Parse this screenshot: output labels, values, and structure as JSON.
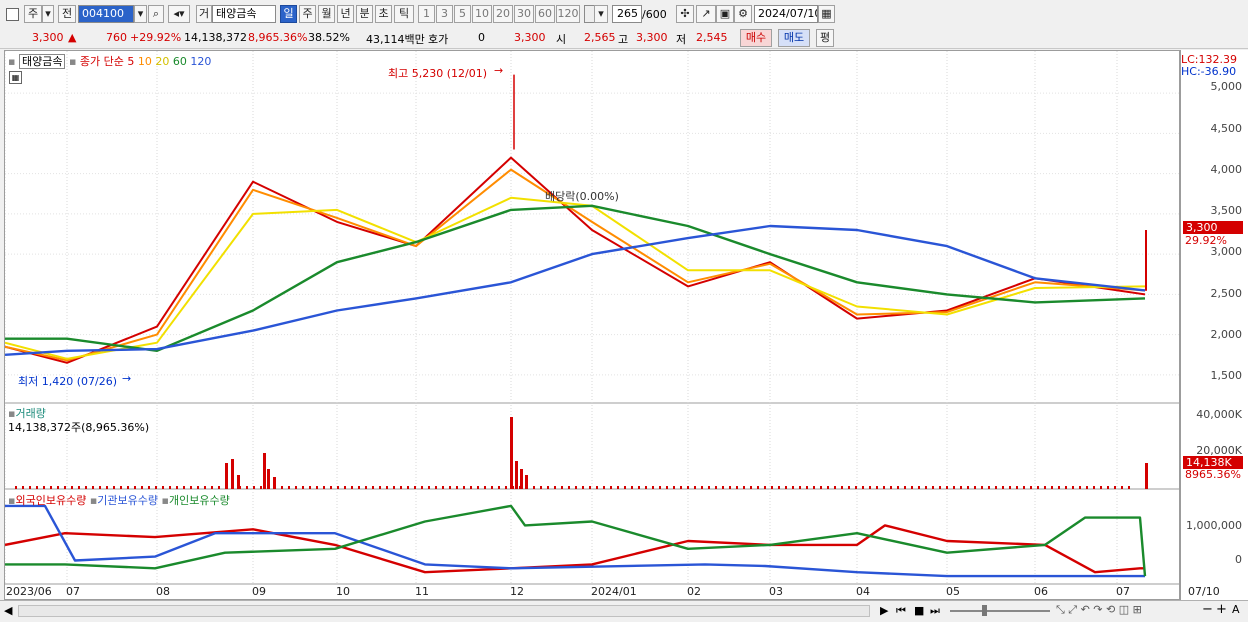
{
  "toolbar": {
    "tab_stock": "주",
    "tab_prev": "전",
    "code": "004100",
    "hoga_label": "거",
    "name": "태양금속",
    "periods": [
      "일",
      "주",
      "월",
      "년",
      "분",
      "초",
      "틱"
    ],
    "selected_period": "일",
    "minutes": [
      "1",
      "3",
      "5",
      "10",
      "20",
      "30",
      "60",
      "120"
    ],
    "count": "265",
    "total": "/600",
    "date": "2024/07/10"
  },
  "quote": {
    "price": "3,300",
    "change": "760",
    "change_pct": "+29.92%",
    "volume": "14,138,372",
    "volume_pct": "8,965.36%",
    "turnover": "38.52%",
    "amount": "43,114백만",
    "hoga_label": "호가",
    "hoga_value": "0",
    "hoga_price": "3,300",
    "open_label": "시",
    "open": "2,565",
    "high_label": "고",
    "high": "3,300",
    "low_label": "저",
    "low": "2,545",
    "buy": "매수",
    "sell": "매도",
    "avg": "평"
  },
  "price_pane": {
    "stock_tag": "태양금속",
    "ma_title": "종가 단순",
    "ma_periods": [
      {
        "label": "5",
        "color": "#d40000"
      },
      {
        "label": "10",
        "color": "#ff8c00"
      },
      {
        "label": "20",
        "color": "#e8d200"
      },
      {
        "label": "60",
        "color": "#1a8a2c"
      },
      {
        "label": "120",
        "color": "#2a55d6"
      }
    ],
    "high_annot": "최고 5,230 (12/01)",
    "low_annot": "최저 1,420 (07/26)",
    "dividend": "배당락(0.00%)",
    "lc": "LC:132.39",
    "hc": "HC:-36.90",
    "last_price": "3,300",
    "last_pct": "29.92%",
    "yticks": [
      "5,000",
      "4,500",
      "4,000",
      "3,500",
      "3,000",
      "2,500",
      "2,000",
      "1,500"
    ]
  },
  "volume_pane": {
    "title": "거래량",
    "value": "14,138,372주(8,965.36%)",
    "yticks": [
      "40,000K",
      "20,000K"
    ],
    "last": "14,138K",
    "last_pct": "8965.36%"
  },
  "holders_pane": {
    "series": [
      {
        "label": "외국인보유수량",
        "color": "#d40000"
      },
      {
        "label": "기관보유수량",
        "color": "#2a55d6"
      },
      {
        "label": "개인보유수량",
        "color": "#1a8a2c"
      }
    ],
    "yticks": [
      "1,000,000",
      "0"
    ]
  },
  "xaxis": [
    "2023/06",
    "07",
    "08",
    "09",
    "10",
    "11",
    "12",
    "2024/01",
    "02",
    "03",
    "04",
    "05",
    "06",
    "07",
    "07/10"
  ],
  "chart_data": {
    "type": "line",
    "title": "",
    "ylim": [
      1300,
      5300
    ],
    "x": [
      "2023/06",
      "07",
      "08",
      "09",
      "10",
      "11",
      "12",
      "2024/01",
      "02",
      "03",
      "04",
      "05",
      "06",
      "07"
    ],
    "series": [
      {
        "name": "5",
        "values": [
          1850,
          1650,
          2100,
          3900,
          3400,
          3100,
          4200,
          3300,
          2600,
          2900,
          2200,
          2300,
          2700,
          2500
        ]
      },
      {
        "name": "10",
        "values": [
          1850,
          1680,
          2000,
          3800,
          3450,
          3100,
          4050,
          3400,
          2650,
          2880,
          2250,
          2280,
          2650,
          2550
        ]
      },
      {
        "name": "20",
        "values": [
          1900,
          1700,
          1900,
          3500,
          3550,
          3150,
          3700,
          3600,
          2800,
          2800,
          2350,
          2250,
          2580,
          2600
        ]
      },
      {
        "name": "60",
        "values": [
          1950,
          1950,
          1800,
          2300,
          2900,
          3150,
          3550,
          3600,
          3350,
          3000,
          2650,
          2500,
          2400,
          2450
        ]
      },
      {
        "name": "120",
        "values": [
          1750,
          1800,
          1820,
          2050,
          2300,
          2450,
          2650,
          3000,
          3200,
          3350,
          3300,
          3100,
          2700,
          2550
        ]
      }
    ]
  }
}
